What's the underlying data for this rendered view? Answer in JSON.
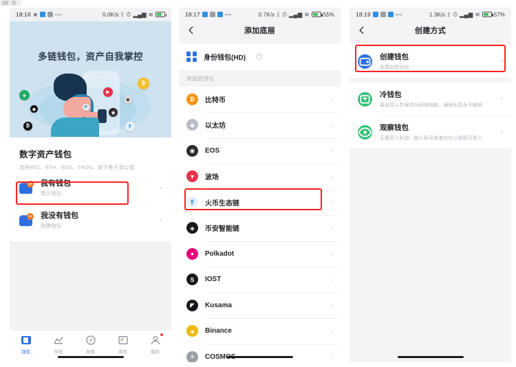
{
  "panel1": {
    "status": {
      "time": "18:16",
      "speed": "0.0K/s",
      "battery": "",
      "icons": [
        "wifi-direct-icon",
        "blue-app-icon",
        "gray-app-icon",
        "more-dots-icon",
        "bluetooth-icon",
        "alarm-icon",
        "signal-icon",
        "wifi-icon",
        "battery-icon"
      ]
    },
    "expand_button": "expand-icon",
    "hero": {
      "title": "多链钱包，资产自我掌控",
      "tokens": [
        "BTC",
        "ETH",
        "EOS",
        "TRX",
        "DOT",
        "HT",
        "BNB",
        "USDT"
      ]
    },
    "card": {
      "title": "数字资产钱包",
      "subtitle": "支持BTC、ETH、EOS、TRON、波卡等主流公链",
      "rows": [
        {
          "title": "我有钱包",
          "subtitle": "导入钱包",
          "badge": "↵"
        },
        {
          "title": "我没有钱包",
          "subtitle": "创建钱包",
          "badge": "+"
        }
      ]
    },
    "tabbar": [
      {
        "label": "钱包",
        "icon": "wallet-icon",
        "active": true,
        "badge": false
      },
      {
        "label": "市场",
        "icon": "market-icon",
        "active": false,
        "badge": false
      },
      {
        "label": "发现",
        "icon": "compass-icon",
        "active": false,
        "badge": false
      },
      {
        "label": "资讯",
        "icon": "news-icon",
        "active": false,
        "badge": false
      },
      {
        "label": "我的",
        "icon": "profile-icon",
        "active": false,
        "badge": true
      }
    ]
  },
  "panel2": {
    "status": {
      "time": "18:17",
      "speed": "0.7K/s",
      "battery": "55%"
    },
    "nav": {
      "back": "back-icon",
      "title": "添加底层"
    },
    "identity_wallet": {
      "label": "身份钱包(HD)",
      "help": "?"
    },
    "group_label": "单底层钱包",
    "coins": [
      {
        "name": "比特币",
        "symbol": "₿",
        "color": "#f7931a",
        "highlighted": false
      },
      {
        "name": "以太坊",
        "symbol": "◆",
        "color": "#b8bcc4",
        "highlighted": false
      },
      {
        "name": "EOS",
        "symbol": "◉",
        "color": "#2b2b2b",
        "highlighted": false
      },
      {
        "name": "波场",
        "symbol": "▼",
        "color": "#e4324a",
        "highlighted": false
      },
      {
        "name": "火币生态链",
        "symbol": "❡",
        "color": "#e8f0ff",
        "highlighted": true
      },
      {
        "name": "币安智能链",
        "symbol": "◈",
        "color": "#17181b",
        "highlighted": false
      },
      {
        "name": "Polkadot",
        "symbol": "●",
        "color": "#e6007a",
        "highlighted": false
      },
      {
        "name": "IOST",
        "symbol": "S",
        "color": "#18191c",
        "highlighted": false
      },
      {
        "name": "Kusama",
        "symbol": "◤",
        "color": "#17181b",
        "highlighted": false
      },
      {
        "name": "Binance",
        "symbol": "◈",
        "color": "#f0b90b",
        "highlighted": false
      },
      {
        "name": "COSMOS",
        "symbol": "✳",
        "color": "#9aa0a6",
        "highlighted": false
      }
    ]
  },
  "panel3": {
    "status": {
      "time": "18:19",
      "speed": "1.3K/s",
      "battery": "57%"
    },
    "nav": {
      "back": "back-icon",
      "title": "创建方式"
    },
    "options": [
      {
        "title": "创建钱包",
        "subtitle": "免费创建钱包",
        "color": "#2f6fe0",
        "icon": "create-wallet-icon",
        "highlighted": true
      },
      {
        "title": "冷钱包",
        "subtitle": "离线导入并保持与网络隔绝，确保私钥永不触网",
        "color": "#37c17a",
        "icon": "cold-wallet-icon",
        "highlighted": false
      },
      {
        "title": "观察钱包",
        "subtitle": "无需导入私钥，输入账号或者对应公钥即可导入",
        "color": "#37c17a",
        "icon": "watch-wallet-icon",
        "highlighted": false
      }
    ]
  },
  "colors": {
    "highlight": "#ff1f1f",
    "accent": "#2f6fe0",
    "hero_bg": "#cfe2f0",
    "page_bg": "#f4f4f6"
  }
}
